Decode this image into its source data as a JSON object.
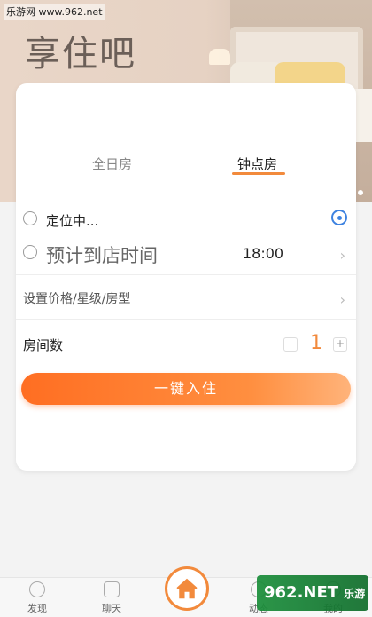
{
  "watermark_top": "乐游网 www.962.net",
  "hero": {
    "title": "享住吧"
  },
  "tabs": {
    "full_day": "全日房",
    "hourly": "钟点房"
  },
  "location": {
    "text": "定位中..."
  },
  "arrival": {
    "label": "预计到店时间",
    "time": "18:00"
  },
  "filter": {
    "label": "设置价格/星级/房型"
  },
  "rooms": {
    "label": "房间数",
    "quantity": "1",
    "minus": "-",
    "plus": "+"
  },
  "cta": {
    "label": "一键入住"
  },
  "tabbar": {
    "discover": "发现",
    "chat": "聊天",
    "dynamic": "动态",
    "mine": "我的"
  },
  "watermark_bottom": {
    "brand": "962.NET",
    "cn": "乐游网"
  },
  "colors": {
    "accent": "#f28a3c",
    "cta_start": "#ff6e22",
    "locate_blue": "#3d82e0"
  }
}
